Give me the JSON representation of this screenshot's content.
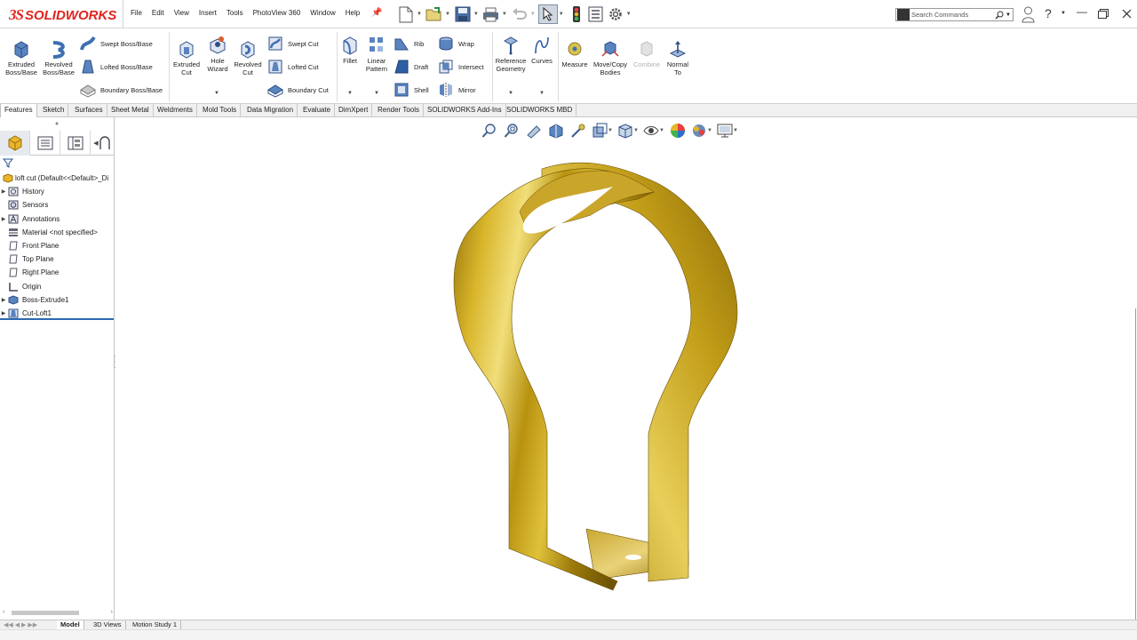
{
  "app": {
    "brand_ds": "3S",
    "brand_word": "SOLIDWORKS"
  },
  "menu": [
    "File",
    "Edit",
    "View",
    "Insert",
    "Tools",
    "PhotoView 360",
    "Window",
    "Help"
  ],
  "search": {
    "placeholder": "Search Commands"
  },
  "ribbon": {
    "extruded_boss": "Extruded\nBoss/Base",
    "revolved_boss": "Revolved\nBoss/Base",
    "swept_boss": "Swept Boss/Base",
    "lofted_boss": "Lofted Boss/Base",
    "boundary_boss": "Boundary Boss/Base",
    "extruded_cut": "Extruded\nCut",
    "hole_wizard": "Hole\nWizard",
    "revolved_cut": "Revolved\nCut",
    "swept_cut": "Swept Cut",
    "lofted_cut": "Lofted Cut",
    "boundary_cut": "Boundary Cut",
    "fillet": "Fillet",
    "linear_pattern": "Linear\nPattern",
    "rib": "Rib",
    "draft": "Draft",
    "shell": "Shell",
    "wrap": "Wrap",
    "intersect": "Intersect",
    "mirror": "Mirror",
    "reference_geometry": "Reference\nGeometry",
    "curves": "Curves",
    "measure": "Measure",
    "move_copy_bodies": "Move/Copy\nBodies",
    "combine": "Combine",
    "normal_to": "Normal\nTo"
  },
  "tabs": [
    "Features",
    "Sketch",
    "Surfaces",
    "Sheet Metal",
    "Weldments",
    "Mold Tools",
    "Data Migration",
    "Evaluate",
    "DimXpert",
    "Render Tools",
    "SOLIDWORKS Add-Ins",
    "SOLIDWORKS MBD"
  ],
  "active_tab": "Features",
  "tree": {
    "root": "loft cut  (Default<<Default>_Di",
    "items": [
      "History",
      "Sensors",
      "Annotations",
      "Material <not specified>",
      "Front Plane",
      "Top Plane",
      "Right Plane",
      "Origin",
      "Boss-Extrude1",
      "Cut-Loft1"
    ]
  },
  "bottom_tabs": [
    "Model",
    "3D Views",
    "Motion Study 1"
  ],
  "colors": {
    "brand_red": "#e3231c",
    "model_gold": "#b8960e",
    "accent_blue": "#2c69b0"
  }
}
